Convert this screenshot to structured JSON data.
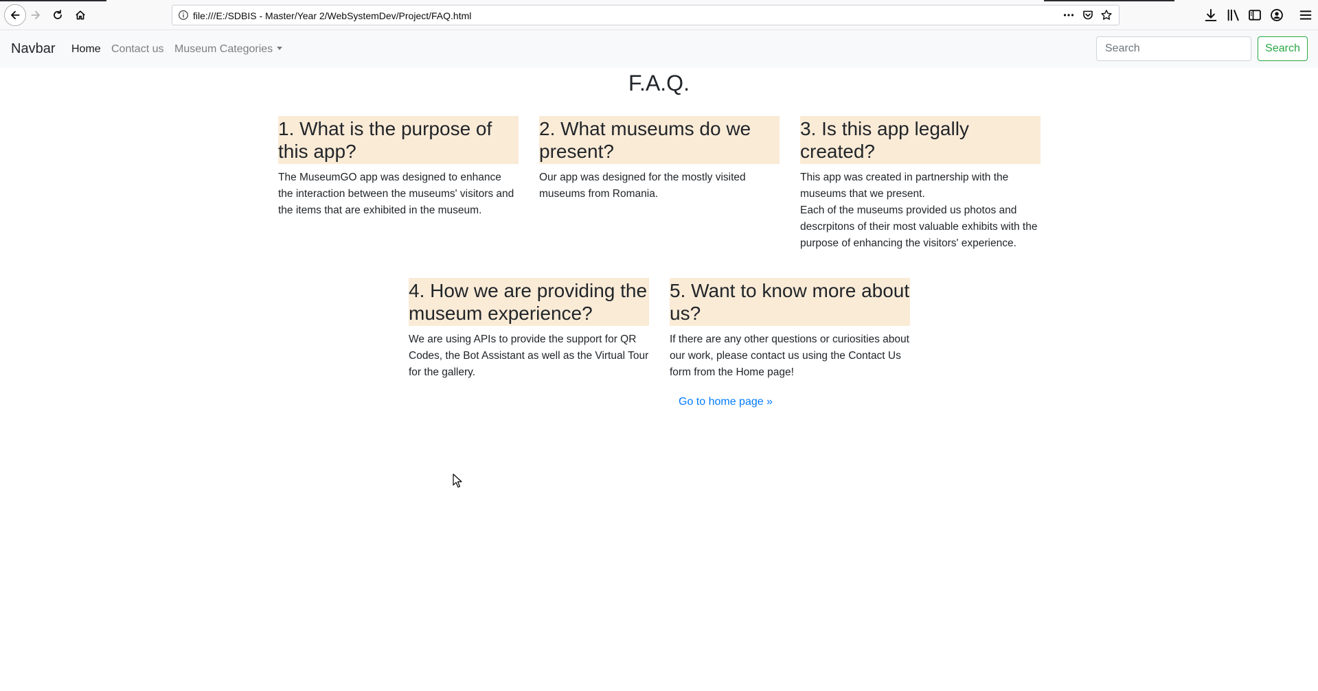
{
  "browser": {
    "url": "file:///E:/SDBIS - Master/Year 2/WebSystemDev/Project/FAQ.html",
    "icons": [
      "back-icon",
      "forward-icon",
      "reload-icon",
      "home-icon",
      "info-icon",
      "more-icon",
      "pocket-icon",
      "bookmark-star-icon",
      "download-icon",
      "library-icon",
      "sidebar-icon",
      "account-icon",
      "menu-icon"
    ]
  },
  "navbar": {
    "brand": "Navbar",
    "links": [
      "Home",
      "Contact us",
      "Museum Categories"
    ],
    "search_placeholder": "Search",
    "search_button": "Search",
    "accent": "#28a745"
  },
  "page": {
    "title": "F.A.Q.",
    "heading_bg": "#faebd7",
    "faqs": [
      {
        "question": "1. What is the purpose of this app?",
        "answer": "The MuseumGO app was designed to enhance the interaction between the museums' visitors and the items that are exhibited in the museum."
      },
      {
        "question": "2. What museums do we present?",
        "answer": "Our app was designed for the mostly visited museums from Romania."
      },
      {
        "question": "3. Is this app legally created?",
        "answer": "This app was created in partnership with the museums that we present.",
        "answer2": "Each of the museums provided us photos and descrpitons of their most valuable exhibits with the purpose of enhancing the visitors' experience."
      },
      {
        "question": "4. How we are providing the museum experience?",
        "answer": "We are using APIs to provide the support for QR Codes, the Bot Assistant as well as the Virtual Tour for the gallery."
      },
      {
        "question": "5. Want to know more about us?",
        "answer": "If there are any other questions or curiosities about our work, please contact us using the Contact Us form from the Home page!"
      }
    ],
    "home_link": "Go to home page »",
    "link_color": "#007bff"
  }
}
